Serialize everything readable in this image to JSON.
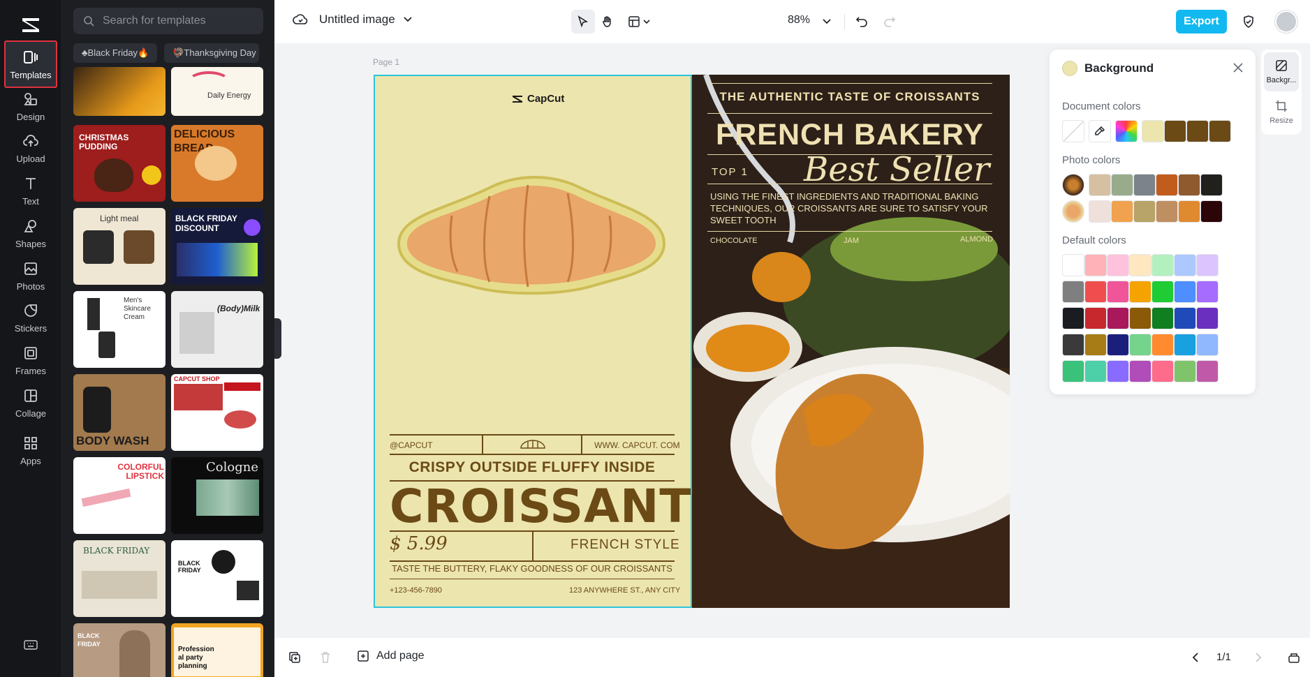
{
  "rail": {
    "items": [
      {
        "label": "Templates",
        "icon": "templates-icon"
      },
      {
        "label": "Design",
        "icon": "design-icon"
      },
      {
        "label": "Upload",
        "icon": "upload-icon"
      },
      {
        "label": "Text",
        "icon": "text-icon"
      },
      {
        "label": "Shapes",
        "icon": "shapes-icon"
      },
      {
        "label": "Photos",
        "icon": "photos-icon"
      },
      {
        "label": "Stickers",
        "icon": "stickers-icon"
      },
      {
        "label": "Frames",
        "icon": "frames-icon"
      },
      {
        "label": "Collage",
        "icon": "collage-icon"
      },
      {
        "label": "Apps",
        "icon": "apps-icon"
      }
    ]
  },
  "panel": {
    "search_placeholder": "Search for templates",
    "chips": [
      "♣Black Friday🔥",
      "🦃Thanksgiving Day"
    ],
    "thumbs": [
      {
        "text": "",
        "color": "#2a1b10"
      },
      {
        "text": "Daily Energy",
        "color": "#fbf6ec"
      },
      {
        "text": "CHRISTMAS PUDDING",
        "color": "#9e1d1d"
      },
      {
        "text": "DELICIOUS BREAD",
        "color": "#d97a2a"
      },
      {
        "text": "Light meal",
        "color": "#efe6d4"
      },
      {
        "text": "BLACK FRIDAY DISCOUNT",
        "color": "#161a3a"
      },
      {
        "text": "Men's Skincare Cream",
        "color": "#ffffff"
      },
      {
        "text": "(Body)Milk",
        "color": "#eeeeee"
      },
      {
        "text": "BODY WASH",
        "color": "#a27a4e"
      },
      {
        "text": "CAPCUT SHOP",
        "color": "#ffffff"
      },
      {
        "text": "COLORFUL LIPSTICK",
        "color": "#ffffff"
      },
      {
        "text": "Cologne",
        "color": "#0c0c0c"
      },
      {
        "text": "BLACK FRIDAY",
        "color": "#e9e4d6"
      },
      {
        "text": "BLACK FRIDAY",
        "color": "#ffffff"
      },
      {
        "text": "BLACK FRIDAY",
        "color": "#b79b83"
      },
      {
        "text": "Profession al party planning",
        "color": "#f1a420"
      }
    ]
  },
  "topbar": {
    "doc_title": "Untitled image",
    "zoom": "88%",
    "export_label": "Export"
  },
  "canvas": {
    "page_label": "Page 1",
    "left": {
      "brand": "CapCut",
      "handle": "@CAPCUT",
      "website": "WWW. CAPCUT. COM",
      "subtitle": "CRISPY OUTSIDE FLUFFY INSIDE",
      "title": "CROISSANT",
      "price": "$  5.99",
      "style": "FRENCH STYLE",
      "tagline": "TASTE THE BUTTERY, FLAKY GOODNESS OF OUR CROISSANTS",
      "phone": "+123-456-7890",
      "address": "123 ANYWHERE ST., ANY CITY"
    },
    "right": {
      "kicker": "THE AUTHENTIC TASTE OF CROISSANTS",
      "title": "FRENCH BAKERY",
      "top": "TOP 1",
      "script": "Best Seller",
      "desc": "USING THE FINEST INGREDIENTS AND TRADITIONAL BAKING TECHNIQUES, OUR CROISSANTS ARE SURE TO SATISFY YOUR SWEET TOOTH",
      "f1": "CHOCOLATE",
      "f2": "JAM",
      "f3": "ALMOND"
    }
  },
  "bgpanel": {
    "title": "Background",
    "doc_colors_label": "Document colors",
    "photo_colors_label": "Photo colors",
    "default_colors_label": "Default colors",
    "doc_colors": [
      "#ece5ae",
      "#6b4a16",
      "#6b4a16",
      "#6b4a16"
    ],
    "photo_colors_row1": [
      "#d7bfa1",
      "#98ac8c",
      "#7c838b",
      "#c25c1c",
      "#8f5a2e",
      "#22201c"
    ],
    "photo_colors_row2": [
      "#f0e0db",
      "#f0a24e",
      "#b8a468",
      "#bf8f62",
      "#e08a30",
      "#2c0508"
    ],
    "default_colors": [
      [
        "#ffffff",
        "#ffb3b8",
        "#ffc2dc",
        "#ffe7bf",
        "#b3f0c0",
        "#adc8ff",
        "#dcc4ff"
      ],
      [
        "#7f7f7f",
        "#f04e4e",
        "#f0559a",
        "#f5a300",
        "#1fcc33",
        "#4f8eff",
        "#a66bff"
      ],
      [
        "#1a1c21",
        "#c6282e",
        "#a8185a",
        "#8a5a08",
        "#0f7f1f",
        "#1f4ab8",
        "#6b2fbf"
      ],
      [
        "#3a3a3a",
        "#a77b15",
        "#1b1f7c",
        "#74d48b",
        "#ff8b2e",
        "#19a0e0",
        "#8fb8ff"
      ],
      [
        "#3ac27a",
        "#4dd0a8",
        "#8a6bff",
        "#b04db8",
        "#ff6b8a",
        "#7fc46b",
        "#c05aa8"
      ]
    ],
    "side_tabs": [
      "Backgr...",
      "Resize"
    ]
  },
  "bottombar": {
    "add_page": "Add page",
    "page_count": "1/1"
  }
}
